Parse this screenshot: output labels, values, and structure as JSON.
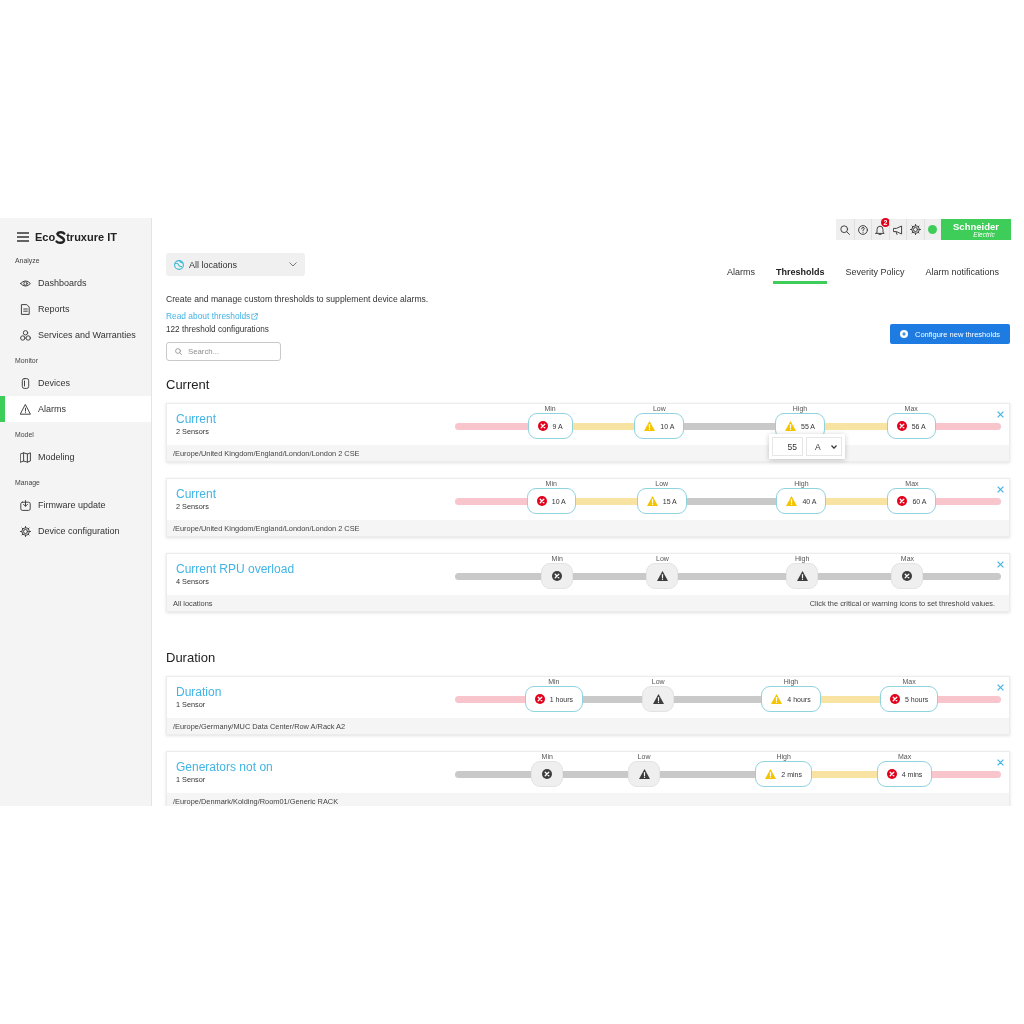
{
  "sidebar": {
    "logo": {
      "before": "Eco",
      "after": "truxure IT"
    },
    "sections": [
      {
        "label": "Analyze",
        "items": [
          {
            "label": "Dashboards",
            "selected": false
          },
          {
            "label": "Reports",
            "selected": false
          },
          {
            "label": "Services and Warranties",
            "selected": false
          }
        ]
      },
      {
        "label": "Monitor",
        "items": [
          {
            "label": "Devices",
            "selected": false
          },
          {
            "label": "Alarms",
            "selected": true
          }
        ]
      },
      {
        "label": "Model",
        "items": [
          {
            "label": "Modeling",
            "selected": false
          }
        ]
      },
      {
        "label": "Manage",
        "items": [
          {
            "label": "Firmware update",
            "selected": false
          },
          {
            "label": "Device configuration",
            "selected": false
          }
        ]
      }
    ]
  },
  "header": {
    "notification_count": "2",
    "brand": {
      "name": "Schneider",
      "tagline": "Electric"
    }
  },
  "location_filter": {
    "value": "All locations"
  },
  "tabs": [
    {
      "label": "Alarms",
      "selected": false
    },
    {
      "label": "Thresholds",
      "selected": true
    },
    {
      "label": "Severity Policy",
      "selected": false
    },
    {
      "label": "Alarm notifications",
      "selected": false
    }
  ],
  "intro": {
    "description": "Create and manage custom thresholds to supplement device alarms.",
    "link": "Read about thresholds",
    "count": "122 threshold configurations"
  },
  "search": {
    "placeholder": "Search..."
  },
  "primary_button": {
    "label": "Configure new thresholds"
  },
  "groups": [
    {
      "title": "Current",
      "cards": [
        {
          "title": "Current",
          "sensors": "2 Sensors",
          "location": "/Europe/United Kingdom/England/London/London 2 CSE",
          "thresholds": [
            {
              "label": "Min",
              "kind": "critical",
              "set": true,
              "value": "9 A"
            },
            {
              "label": "Low",
              "kind": "warning",
              "set": true,
              "value": "10 A"
            },
            {
              "label": "High",
              "kind": "warning",
              "set": true,
              "value": "55 A",
              "editor": {
                "value": "55",
                "unit": "A"
              }
            },
            {
              "label": "Max",
              "kind": "critical",
              "set": true,
              "value": "56 A"
            }
          ]
        },
        {
          "title": "Current",
          "sensors": "2 Sensors",
          "location": "/Europe/United Kingdom/England/London/London 2 CSE",
          "thresholds": [
            {
              "label": "Min",
              "kind": "critical",
              "set": true,
              "value": "10 A"
            },
            {
              "label": "Low",
              "kind": "warning",
              "set": true,
              "value": "15 A"
            },
            {
              "label": "High",
              "kind": "warning",
              "set": true,
              "value": "40 A"
            },
            {
              "label": "Max",
              "kind": "critical",
              "set": true,
              "value": "60 A"
            }
          ]
        },
        {
          "title": "Current RPU overload",
          "sensors": "4 Sensors",
          "location": "All locations",
          "hint": "Click the critical or warning icons to set threshold values.",
          "thresholds": [
            {
              "label": "Min",
              "kind": "critical",
              "set": false
            },
            {
              "label": "Low",
              "kind": "warning",
              "set": false
            },
            {
              "label": "High",
              "kind": "warning",
              "set": false
            },
            {
              "label": "Max",
              "kind": "critical",
              "set": false
            }
          ]
        }
      ]
    },
    {
      "title": "Duration",
      "cards": [
        {
          "title": "Duration",
          "sensors": "1 Sensor",
          "location": "/Europe/Germany/MUC Data Center/Row A/Rack A2",
          "thresholds": [
            {
              "label": "Min",
              "kind": "critical",
              "set": true,
              "value": "1 hours"
            },
            {
              "label": "Low",
              "kind": "warning",
              "set": false
            },
            {
              "label": "High",
              "kind": "warning",
              "set": true,
              "value": "4 hours"
            },
            {
              "label": "Max",
              "kind": "critical",
              "set": true,
              "value": "5 hours"
            }
          ]
        },
        {
          "title": "Generators not on",
          "sensors": "1 Sensor",
          "location": "/Europe/Denmark/Kolding/Room01/Generic RACK",
          "thresholds": [
            {
              "label": "Min",
              "kind": "critical",
              "set": false
            },
            {
              "label": "Low",
              "kind": "warning",
              "set": false
            },
            {
              "label": "High",
              "kind": "warning",
              "set": true,
              "value": "2 mins"
            },
            {
              "label": "Max",
              "kind": "critical",
              "set": true,
              "value": "4 mins"
            }
          ]
        }
      ]
    }
  ]
}
